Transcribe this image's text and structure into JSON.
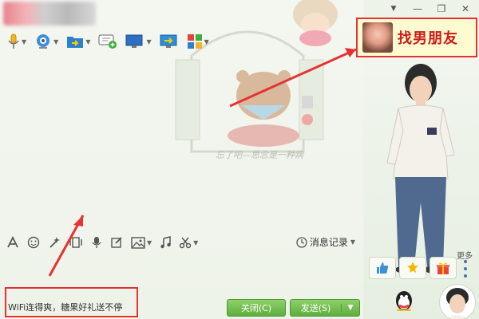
{
  "window": {
    "minimize_glyph": "—",
    "restore_glyph": "❐",
    "close_glyph": "✕"
  },
  "toolbar": {
    "items": [
      {
        "icon": "microphone-icon"
      },
      {
        "icon": "video-camera-icon"
      },
      {
        "icon": "file-transfer-icon"
      },
      {
        "icon": "message-add-icon"
      },
      {
        "icon": "screen-share-icon"
      },
      {
        "icon": "remote-assist-icon"
      },
      {
        "icon": "apps-grid-icon"
      }
    ]
  },
  "chat_background": {
    "caption": "忘了吧—思念是一种病"
  },
  "input_toolbar": {
    "message_record_label": "消息记录",
    "items": [
      "font-icon",
      "emoji-icon",
      "magic-icon",
      "shake-icon",
      "voice-icon",
      "edit-icon",
      "image-icon",
      "music-icon",
      "scissors-icon"
    ]
  },
  "input": {
    "text": "WiFi连得爽，糖果好礼送不停"
  },
  "buttons": {
    "close_label": "关闭(C)",
    "send_label": "发送(S)",
    "send_dropdown": "▼"
  },
  "side": {
    "ad_text": "找男朋友",
    "more_label": "更多"
  },
  "colors": {
    "accent_green": "#5fae3e",
    "highlight_red": "#e53333"
  }
}
